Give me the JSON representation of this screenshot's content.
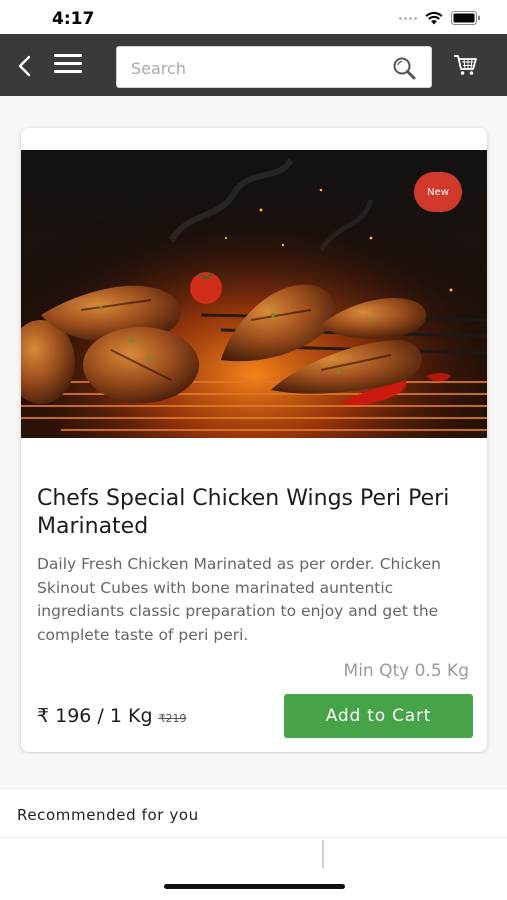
{
  "status": {
    "time": "4:17"
  },
  "app_bar": {
    "search_placeholder": "Search"
  },
  "product": {
    "badge": "New",
    "title": "Chefs Special Chicken Wings Peri Peri Marinated",
    "description": "Daily Fresh Chicken Marinated as per order. Chicken Skinout Cubes with bone marinated auntentic ingrediants classic preparation to enjoy and get the complete taste of peri peri.",
    "min_qty": "Min Qty 0.5 Kg",
    "price": "₹ 196 / 1 Kg",
    "price_old": "₹219",
    "add_to_cart_label": "Add to Cart"
  },
  "recommended": {
    "label": "Recommended for you"
  },
  "colors": {
    "app_bar": "#3a3a3a",
    "add_to_cart": "#47a347",
    "badge": "#d13a2b"
  },
  "icons": {
    "back": "chevron-left-icon",
    "menu": "hamburger-icon",
    "search": "search-icon",
    "cart": "cart-icon"
  }
}
